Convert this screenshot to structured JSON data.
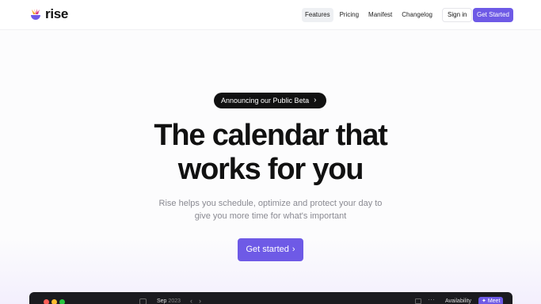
{
  "brand": {
    "name": "rise"
  },
  "nav": {
    "items": [
      {
        "label": "Features",
        "active": true
      },
      {
        "label": "Pricing",
        "active": false
      },
      {
        "label": "Manifest",
        "active": false
      },
      {
        "label": "Changelog",
        "active": false
      }
    ],
    "signin_label": "Sign in",
    "cta_label": "Get Started"
  },
  "hero": {
    "announcement": "Announcing our Public Beta",
    "headline_line1": "The calendar that",
    "headline_line2": "works for you",
    "sub_line1": "Rise helps you schedule, optimize and protect your day to",
    "sub_line2": "give you more time for what's important",
    "cta_label": "Get started"
  },
  "app_preview": {
    "month": "Sep",
    "year": "2023",
    "availability_label": "Availability",
    "meet_label": "Meet"
  },
  "colors": {
    "accent": "#6e5ae6",
    "dark": "#111111",
    "muted_text": "#8a8a92"
  }
}
